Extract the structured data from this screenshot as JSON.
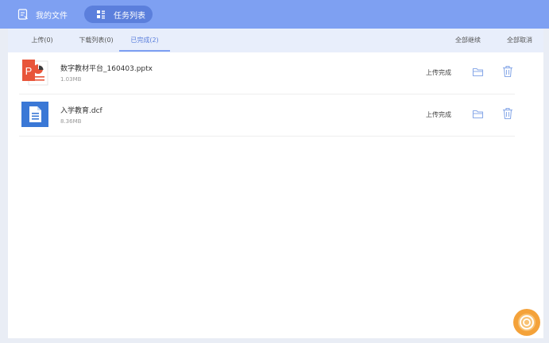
{
  "nav": {
    "my_files": "我的文件",
    "task_list": "任务列表"
  },
  "tabs": {
    "upload": "上传(0)",
    "download": "下载列表(0)",
    "completed": "已完成(2)"
  },
  "actions": {
    "resume_all": "全部继续",
    "cancel_all": "全部取消"
  },
  "files": [
    {
      "name": "数字教材平台_160403.pptx",
      "size": "1.03MB",
      "status": "上传完成",
      "type_icon": "pptx-file-icon"
    },
    {
      "name": "入学教育.dcf",
      "size": "8.36MB",
      "status": "上传完成",
      "type_icon": "document-file-icon"
    }
  ],
  "colors": {
    "accent": "#7ea0f2",
    "accent_dark": "#5b7fdc",
    "pptx": "#e8553a",
    "doc": "#3a78d6",
    "float_button": "#f4a23a"
  }
}
